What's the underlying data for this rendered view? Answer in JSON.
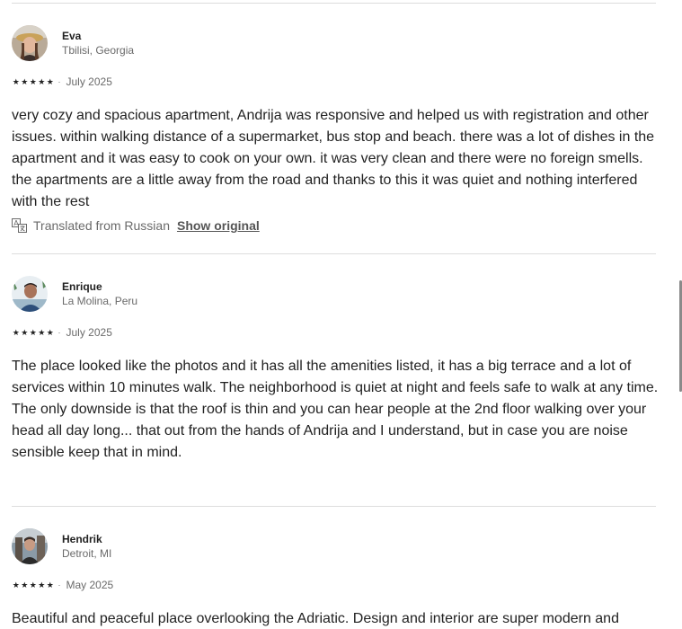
{
  "reviews": [
    {
      "name": "Eva",
      "location": "Tbilisi, Georgia",
      "rating": 5,
      "stars": "★★★★★",
      "separator": "·",
      "date": "July 2025",
      "paragraphs": [
        "very cozy and spacious apartment, Andrija was responsive and helped us with registration and other issues. within walking distance of a supermarket, bus stop and beach. there was a lot of dishes in the apartment and it was easy to cook on your own. it was very clean and there were no foreign smells. the apartments are a little away from the road and thanks to this it was quiet and nothing interfered with the rest"
      ],
      "translated_label": "Translated from Russian",
      "show_original_label": "Show original"
    },
    {
      "name": "Enrique",
      "location": "La Molina, Peru",
      "rating": 5,
      "stars": "★★★★★",
      "separator": "·",
      "date": "July 2025",
      "paragraphs": [
        "The place looked like the photos and it has all the amenities listed, it has a big terrace and a lot of services within 10 minutes walk. The neighborhood is quiet at night and feels safe to walk at any time.",
        "The only downside is that the roof is thin and you can hear people at the 2nd floor walking over your head all day long... that out from the hands of Andrija and I understand, but in case you are noise sensible keep that in mind."
      ]
    },
    {
      "name": "Hendrik",
      "location": "Detroit, MI",
      "rating": 5,
      "stars": "★★★★★",
      "separator": "·",
      "date": "May 2025",
      "paragraphs": [
        "Beautiful and peaceful place overlooking the Adriatic. Design and interior are super modern and"
      ]
    }
  ],
  "icons": {
    "translate": "translate-icon",
    "star": "star-icon"
  },
  "colors": {
    "text": "#222222",
    "secondary": "#6a6a6a",
    "divider": "#dddddd"
  }
}
